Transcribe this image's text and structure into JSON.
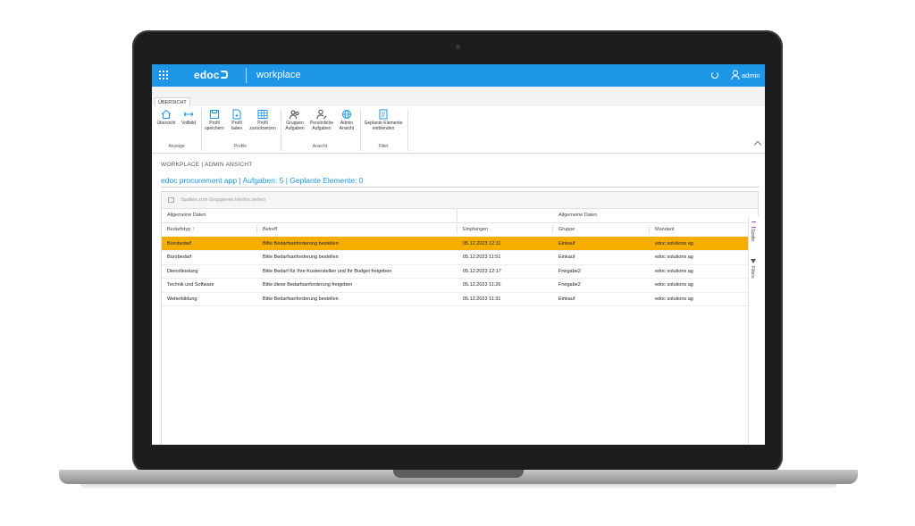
{
  "app": {
    "logo": "edoc",
    "workplace": "workplace",
    "user": "admin"
  },
  "tabs": [
    "ÜBERSICHT"
  ],
  "ribbon": {
    "groups": [
      {
        "label": "Anzeige",
        "buttons": [
          "Übersicht",
          "Vollbild"
        ]
      },
      {
        "label": "Profile",
        "buttons": [
          "Profil speichern",
          "Profil laden",
          "Profil zurücksetzen"
        ]
      },
      {
        "label": "Ansicht",
        "buttons": [
          "Gruppen Aufgaben",
          "Persönliche Aufgaben",
          "Admin Ansicht"
        ]
      },
      {
        "label": "Filter",
        "buttons": [
          "Geplante Elemente einblenden"
        ]
      }
    ]
  },
  "page": {
    "breadcrumb": "WORKPLACE | ADMIN ANSICHT",
    "title": "edoc procurement app | Aufgaben: 5 | Geplante Elemente: 0"
  },
  "grid": {
    "group_hint": "Spalten zum Gruppieren hierhin ziehen",
    "bands": [
      "Allgemeine Daten",
      "Allgemeine Daten"
    ],
    "columns": [
      "Bedarfstyp",
      "Betreff",
      "Empfangen",
      "Gruppe",
      "Mandant"
    ],
    "sort_indicator": "↑",
    "rows": [
      {
        "bedarfstyp": "Bürobedarf",
        "betreff": "Bitte Bedarfsanforderung bestellen",
        "empfangen": "05.12.2023 12:11",
        "gruppe": "Einkauf",
        "mandant": "edoc solutions ag",
        "selected": true
      },
      {
        "bedarfstyp": "Bürobedarf",
        "betreff": "Bitte Bedarfsanforderung bestellen",
        "empfangen": "05.12.2023 11:51",
        "gruppe": "Einkauf",
        "mandant": "edoc solutions ag",
        "selected": false
      },
      {
        "bedarfstyp": "Dienstleistung",
        "betreff": "Bitte Bedarf für Ihre Kostenstellen und Ihr Budget freigeben",
        "empfangen": "05.12.2023 12:17",
        "gruppe": "Freigabe2",
        "mandant": "edoc solutions ag",
        "selected": false
      },
      {
        "bedarfstyp": "Technik und Software",
        "betreff": "Bitte diese Bedarfsanforderung freigeben",
        "empfangen": "05.12.2023 11:26",
        "gruppe": "Freigabe2",
        "mandant": "edoc solutions ag",
        "selected": false
      },
      {
        "bedarfstyp": "Weiterbildung",
        "betreff": "Bitte Bedarfsanforderung bestellen",
        "empfangen": "05.12.2023 11:31",
        "gruppe": "Einkauf",
        "mandant": "edoc solutions ag",
        "selected": false
      }
    ],
    "side_tabs": [
      "Spalte",
      "Filters"
    ]
  },
  "colors": {
    "accent": "#1d96e8",
    "selected_row": "#f5ae00"
  }
}
